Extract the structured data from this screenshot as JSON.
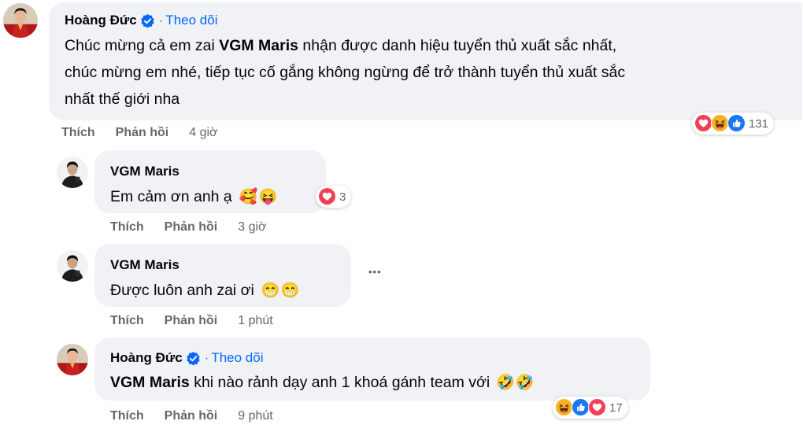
{
  "comments": [
    {
      "author": "Hoàng Đức",
      "follow_label": "Theo dõi",
      "separator": "·",
      "text_lines": [
        [
          "Chúc mừng cả em zai ",
          "VGM Maris",
          " nhận được danh hiệu tuyển thủ xuất sắc nhất,"
        ],
        [
          "chúc mừng em nhé, tiếp tục cố gắng không ngừng để trở thành tuyển thủ xuất sắc"
        ],
        [
          "nhất thế giới nha"
        ]
      ],
      "like_label": "Thích",
      "reply_label": "Phản hồi",
      "time": "4 giờ",
      "reactions": [
        "love",
        "haha",
        "like"
      ],
      "reaction_count": "131",
      "verified": true
    },
    {
      "author": "VGM Maris",
      "text": "Em cảm ơn anh ạ",
      "emojis": [
        "🥰",
        "😝"
      ],
      "like_label": "Thích",
      "reply_label": "Phản hồi",
      "time": "3 giờ",
      "reactions": [
        "love"
      ],
      "reaction_count": "3"
    },
    {
      "author": "VGM Maris",
      "text": "Được luôn anh zai ơi",
      "emojis": [
        "😁",
        "😁"
      ],
      "like_label": "Thích",
      "reply_label": "Phản hồi",
      "time": "1 phút",
      "more_label": "•••"
    },
    {
      "author": "Hoàng Đức",
      "follow_label": "Theo dõi",
      "separator": "·",
      "mention": "VGM Maris",
      "text": " khi nào rảnh dạy anh 1 khoá gánh team với",
      "emojis": [
        "🤣",
        "🤣"
      ],
      "like_label": "Thích",
      "reply_label": "Phản hồi",
      "time": "9 phút",
      "reactions": [
        "haha",
        "like",
        "love"
      ],
      "reaction_count": "17",
      "verified": true
    }
  ],
  "colors": {
    "bubble": "#f0f2f5",
    "link_blue": "#0866ff",
    "meta_gray": "#65676b",
    "like_blue": "#1877f2",
    "love_red": "#f33e58",
    "haha_yellow": "#f7b125"
  }
}
